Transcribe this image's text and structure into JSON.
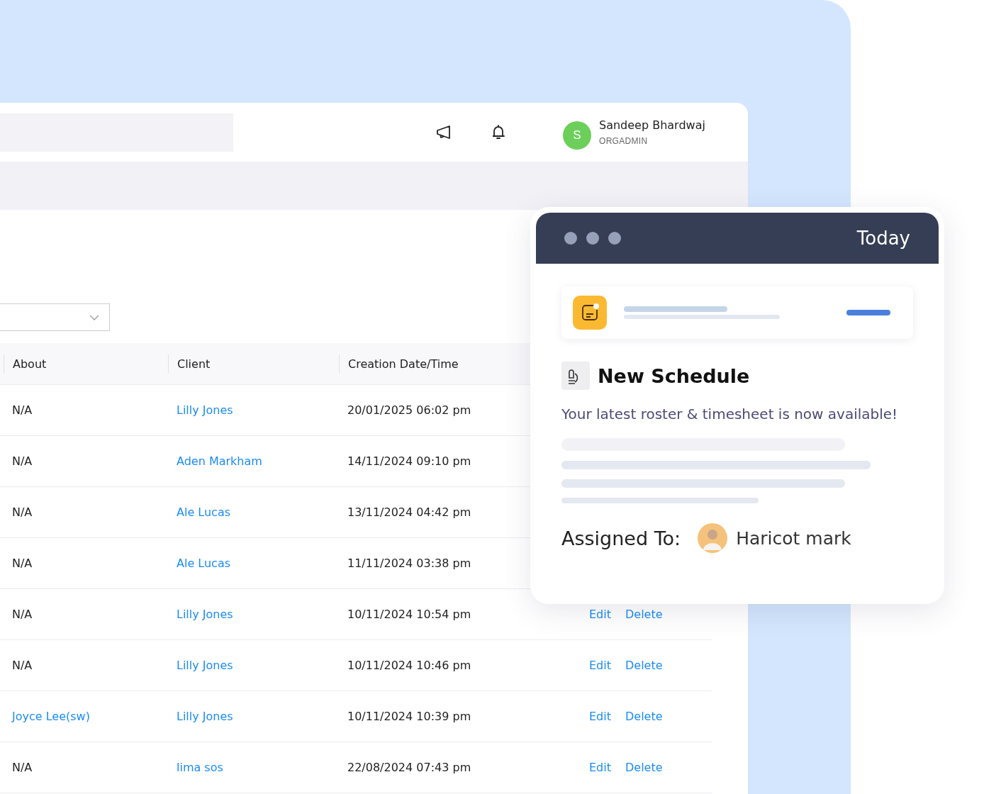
{
  "header": {
    "user": {
      "initial": "S",
      "name": "Sandeep Bhardwaj",
      "role": "ORGADMIN"
    }
  },
  "table": {
    "columns": [
      "About",
      "Client",
      "Creation Date/Time"
    ],
    "rows": [
      {
        "about": "N/A",
        "about_link": false,
        "client": "Lilly Jones",
        "created": "20/01/2025 06:02 pm"
      },
      {
        "about": "N/A",
        "about_link": false,
        "client": "Aden Markham",
        "created": "14/11/2024 09:10 pm"
      },
      {
        "about": "N/A",
        "about_link": false,
        "client": "Ale Lucas",
        "created": "13/11/2024 04:42 pm"
      },
      {
        "about": "N/A",
        "about_link": false,
        "client": "Ale Lucas",
        "created": "11/11/2024 03:38 pm"
      },
      {
        "about": "N/A",
        "about_link": false,
        "client": "Lilly Jones",
        "created": "10/11/2024 10:54 pm",
        "actions": [
          "Edit",
          "Delete"
        ]
      },
      {
        "about": "N/A",
        "about_link": false,
        "client": "Lilly Jones",
        "created": "10/11/2024 10:46 pm",
        "actions": [
          "Edit",
          "Delete"
        ]
      },
      {
        "about": "Joyce Lee(sw)",
        "about_link": true,
        "client": "Lilly Jones",
        "created": "10/11/2024 10:39 pm",
        "actions": [
          "Edit",
          "Delete"
        ]
      },
      {
        "about": "N/A",
        "about_link": false,
        "client": "lima sos",
        "created": "22/08/2024 07:43 pm",
        "actions": [
          "Edit",
          "Delete"
        ]
      }
    ]
  },
  "card": {
    "title": "Today",
    "heading": "New Schedule",
    "message": "Your latest roster & timesheet is now available!",
    "assigned_label": "Assigned To:",
    "assignee": "Haricot mark"
  }
}
